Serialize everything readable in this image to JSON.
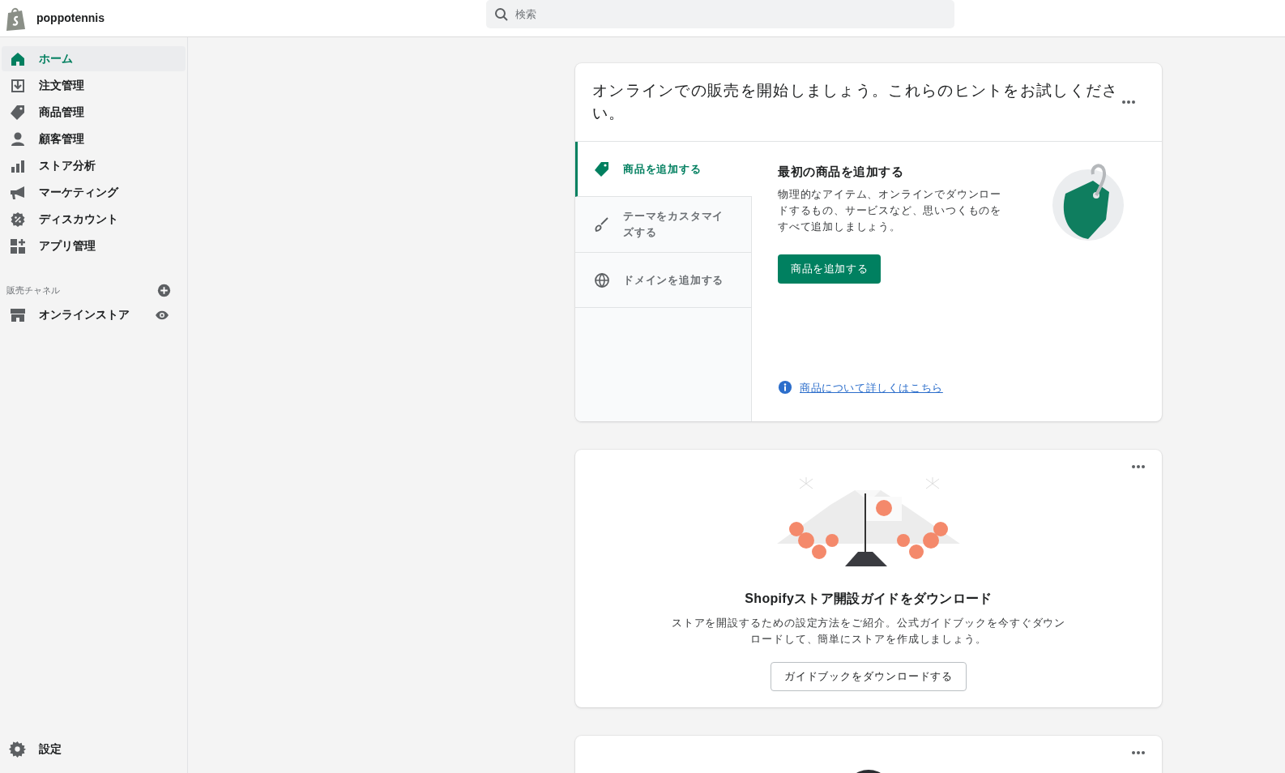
{
  "store_name": "poppotennis",
  "search": {
    "placeholder": "検索"
  },
  "nav": [
    {
      "label": "ホーム",
      "selected": true
    },
    {
      "label": "注文管理",
      "selected": false
    },
    {
      "label": "商品管理",
      "selected": false
    },
    {
      "label": "顧客管理",
      "selected": false
    },
    {
      "label": "ストア分析",
      "selected": false
    },
    {
      "label": "マーケティング",
      "selected": false
    },
    {
      "label": "ディスカウント",
      "selected": false
    },
    {
      "label": "アプリ管理",
      "selected": false
    }
  ],
  "sales_channels": {
    "heading": "販売チャネル",
    "items": [
      {
        "label": "オンラインストア"
      }
    ]
  },
  "settings": {
    "label": "設定"
  },
  "hints_card": {
    "title": "オンラインでの販売を開始しましょう。これらのヒントをお試しください。",
    "tabs": [
      {
        "label": "商品を追加する",
        "selected": true
      },
      {
        "label": "テーマをカスタマイズする",
        "selected": false
      },
      {
        "label": "ドメインを追加する",
        "selected": false
      }
    ],
    "panel": {
      "heading": "最初の商品を追加する",
      "body": "物理的なアイテム、オンラインでダウンロードするもの、サービスなど、思いつくものをすべて追加しましょう。",
      "button": "商品を追加する",
      "link": "商品について詳しくはこちら"
    }
  },
  "guide_card": {
    "title": "Shopifyストア開設ガイドをダウンロード",
    "body": "ストアを開設するための設定方法をご紹介。公式ガイドブックを今すぐダウンロードして、簡単にストアを作成しましょう。",
    "button": "ガイドブックをダウンロードする"
  }
}
